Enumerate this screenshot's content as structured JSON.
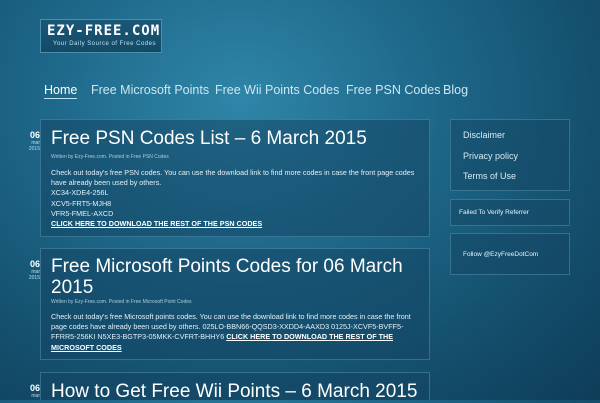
{
  "logo": {
    "title": "EZY-FREE.COM",
    "tagline": "Your Daily Source of Free Codes"
  },
  "nav": [
    "Home",
    "Free Microsoft Points",
    "Free Wii Points Codes",
    "Free PSN Codes",
    "Blog"
  ],
  "posts": [
    {
      "day": "06",
      "month": "mar",
      "year": "2015",
      "title": "Free PSN Codes List – 6 March 2015",
      "meta": "Written by Ezy-Free.com. Posted in Free PSN Codes",
      "body": "Check out today's free PSN codes. You can use the download link to find more codes in case the front page codes have already been used by others.",
      "codes": [
        "XC34-XDE4-256L",
        "XCV5-FRT5-MJH8",
        "VFR5-FMEL-AXCD"
      ],
      "link": "CLICK HERE TO DOWNLOAD THE REST OF THE PSN CODES"
    },
    {
      "day": "06",
      "month": "mar",
      "year": "2015",
      "title_line1": "Free Microsoft Points Codes for 06 March",
      "title_line2": "2015",
      "meta": "Written by Ezy-Free.com. Posted in Free Microsoft Point Codes",
      "body": "Check out today's free Microsoft points codes. You can use the download link to find more codes in case the front page codes have already been used by others.    025LO-BBN66-QQSD3-XXDD4-AAXD3 0125J-XCVF5-BVFF5-FFRR5-256KI N5XE3-BGTP3-05MKK-CVFRT-BHHY6",
      "link": "CLICK HERE TO DOWNLOAD THE REST OF THE MICROSOFT CODES"
    },
    {
      "day": "06",
      "month": "mar",
      "year": "2015",
      "title": "How to Get Free Wii Points – 6 March 2015"
    }
  ],
  "sidebar": {
    "links": [
      "Disclaimer",
      "Privacy policy",
      "Terms of Use"
    ],
    "referrer": "Failed To Verify Referrer",
    "follow": "Follow @EzyFreeDotCom"
  }
}
